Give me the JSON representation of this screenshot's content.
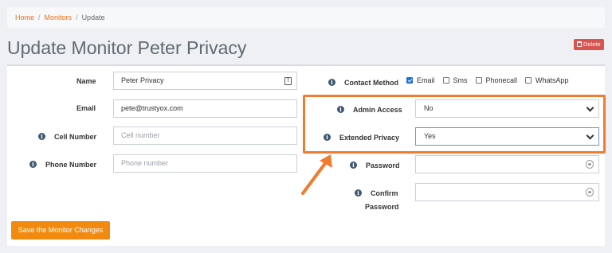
{
  "breadcrumb": {
    "home": "Home",
    "monitors": "Monitors",
    "current": "Update",
    "separator": "/"
  },
  "page": {
    "title": "Update Monitor Peter Privacy",
    "delete_label": "Delete"
  },
  "form": {
    "name": {
      "label": "Name",
      "value": "Peter Privacy"
    },
    "email": {
      "label": "Email",
      "value": "pete@trustyox.com"
    },
    "cell_number": {
      "label": "Cell Number",
      "placeholder": "Cell number"
    },
    "phone_number": {
      "label": "Phone Number",
      "placeholder": "Phone number"
    },
    "contact_method": {
      "label": "Contact Method",
      "options": [
        {
          "label": "Email",
          "checked": true
        },
        {
          "label": "Sms",
          "checked": false
        },
        {
          "label": "Phonecall",
          "checked": false
        },
        {
          "label": "WhatsApp",
          "checked": false
        }
      ]
    },
    "admin_access": {
      "label": "Admin Access",
      "value": "No"
    },
    "extended_privacy": {
      "label": "Extended Privacy",
      "value": "Yes"
    },
    "password": {
      "label": "Password",
      "value": ""
    },
    "confirm_password": {
      "label_line1": "Confirm",
      "label_line2": "Password",
      "value": ""
    },
    "save_label": "Save the Monitor Changes"
  },
  "icons": {
    "info": "i",
    "key": "!"
  },
  "colors": {
    "accent": "#f28a0f",
    "highlight": "#f07c31",
    "danger": "#d9534f",
    "info_icon": "#3d5772",
    "checkbox": "#1e6fd9"
  }
}
